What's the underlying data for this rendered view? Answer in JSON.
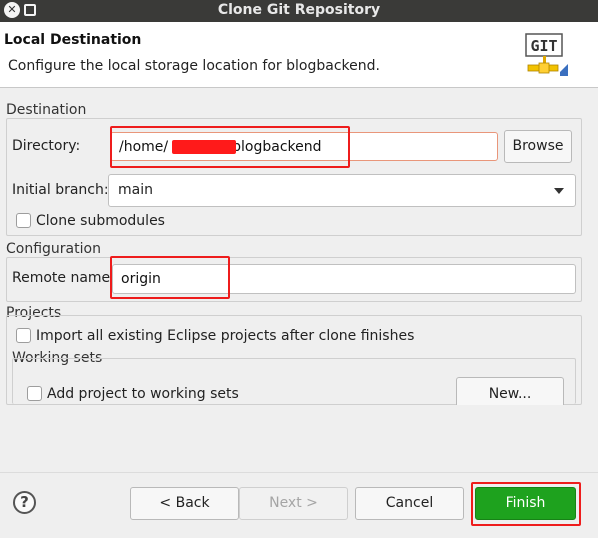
{
  "window": {
    "title": "Clone Git Repository"
  },
  "header": {
    "title": "Local Destination",
    "description": "Configure the local storage location for blogbackend.",
    "logo_text": "GIT"
  },
  "destination": {
    "group_label": "Destination",
    "directory_label": "Directory:",
    "directory_prefix": "/home/",
    "directory_suffix": "blogbackend",
    "browse_label": "Browse",
    "branch_label": "Initial branch:",
    "branch_value": "main",
    "clone_submodules_label": "Clone submodules",
    "clone_submodules_checked": false
  },
  "configuration": {
    "group_label": "Configuration",
    "remote_name_label": "Remote name:",
    "remote_name_value": "origin"
  },
  "projects": {
    "group_label": "Projects",
    "import_label": "Import all existing Eclipse projects after clone finishes",
    "import_checked": false,
    "working_sets_label": "Working sets",
    "add_to_working_sets_label": "Add project to working sets",
    "add_to_working_sets_checked": false,
    "new_button_label": "New..."
  },
  "footer": {
    "back_label": "< Back",
    "next_label": "Next >",
    "cancel_label": "Cancel",
    "finish_label": "Finish"
  },
  "colors": {
    "annotation_red": "#ee1c1c",
    "finish_green": "#1ea21e"
  },
  "icons": {
    "help": "question-circle-icon",
    "close": "close-icon",
    "maximize": "maximize-icon",
    "dropdown": "chevron-down-icon"
  }
}
